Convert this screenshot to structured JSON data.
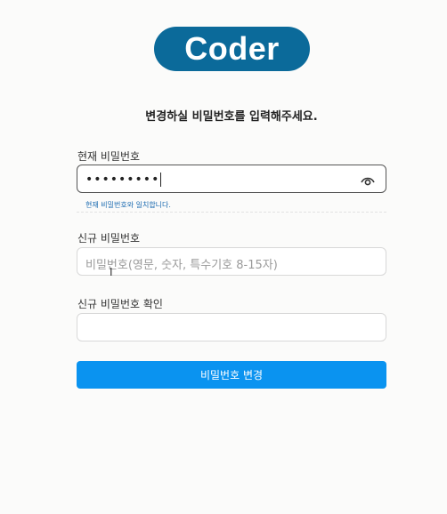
{
  "logo_text": "Coder",
  "subtitle": "변경하실 비밀번호를 입력해주세요.",
  "current_password": {
    "label": "현재 비밀번호",
    "masked_value": "•••••••••",
    "hint": "현재 비밀번호와 일치합니다."
  },
  "new_password": {
    "label": "신규 비밀번호",
    "placeholder": "비밀번호(영문, 숫자, 특수기호 8-15자)"
  },
  "confirm_password": {
    "label": "신규 비밀번호 확인",
    "value": ""
  },
  "submit_label": "비밀번호 변경",
  "colors": {
    "brand": "#0b6a9a",
    "button": "#0a93f0",
    "hint": "#1a6ab0"
  },
  "icons": {
    "toggle_visibility": "eye-icon"
  }
}
